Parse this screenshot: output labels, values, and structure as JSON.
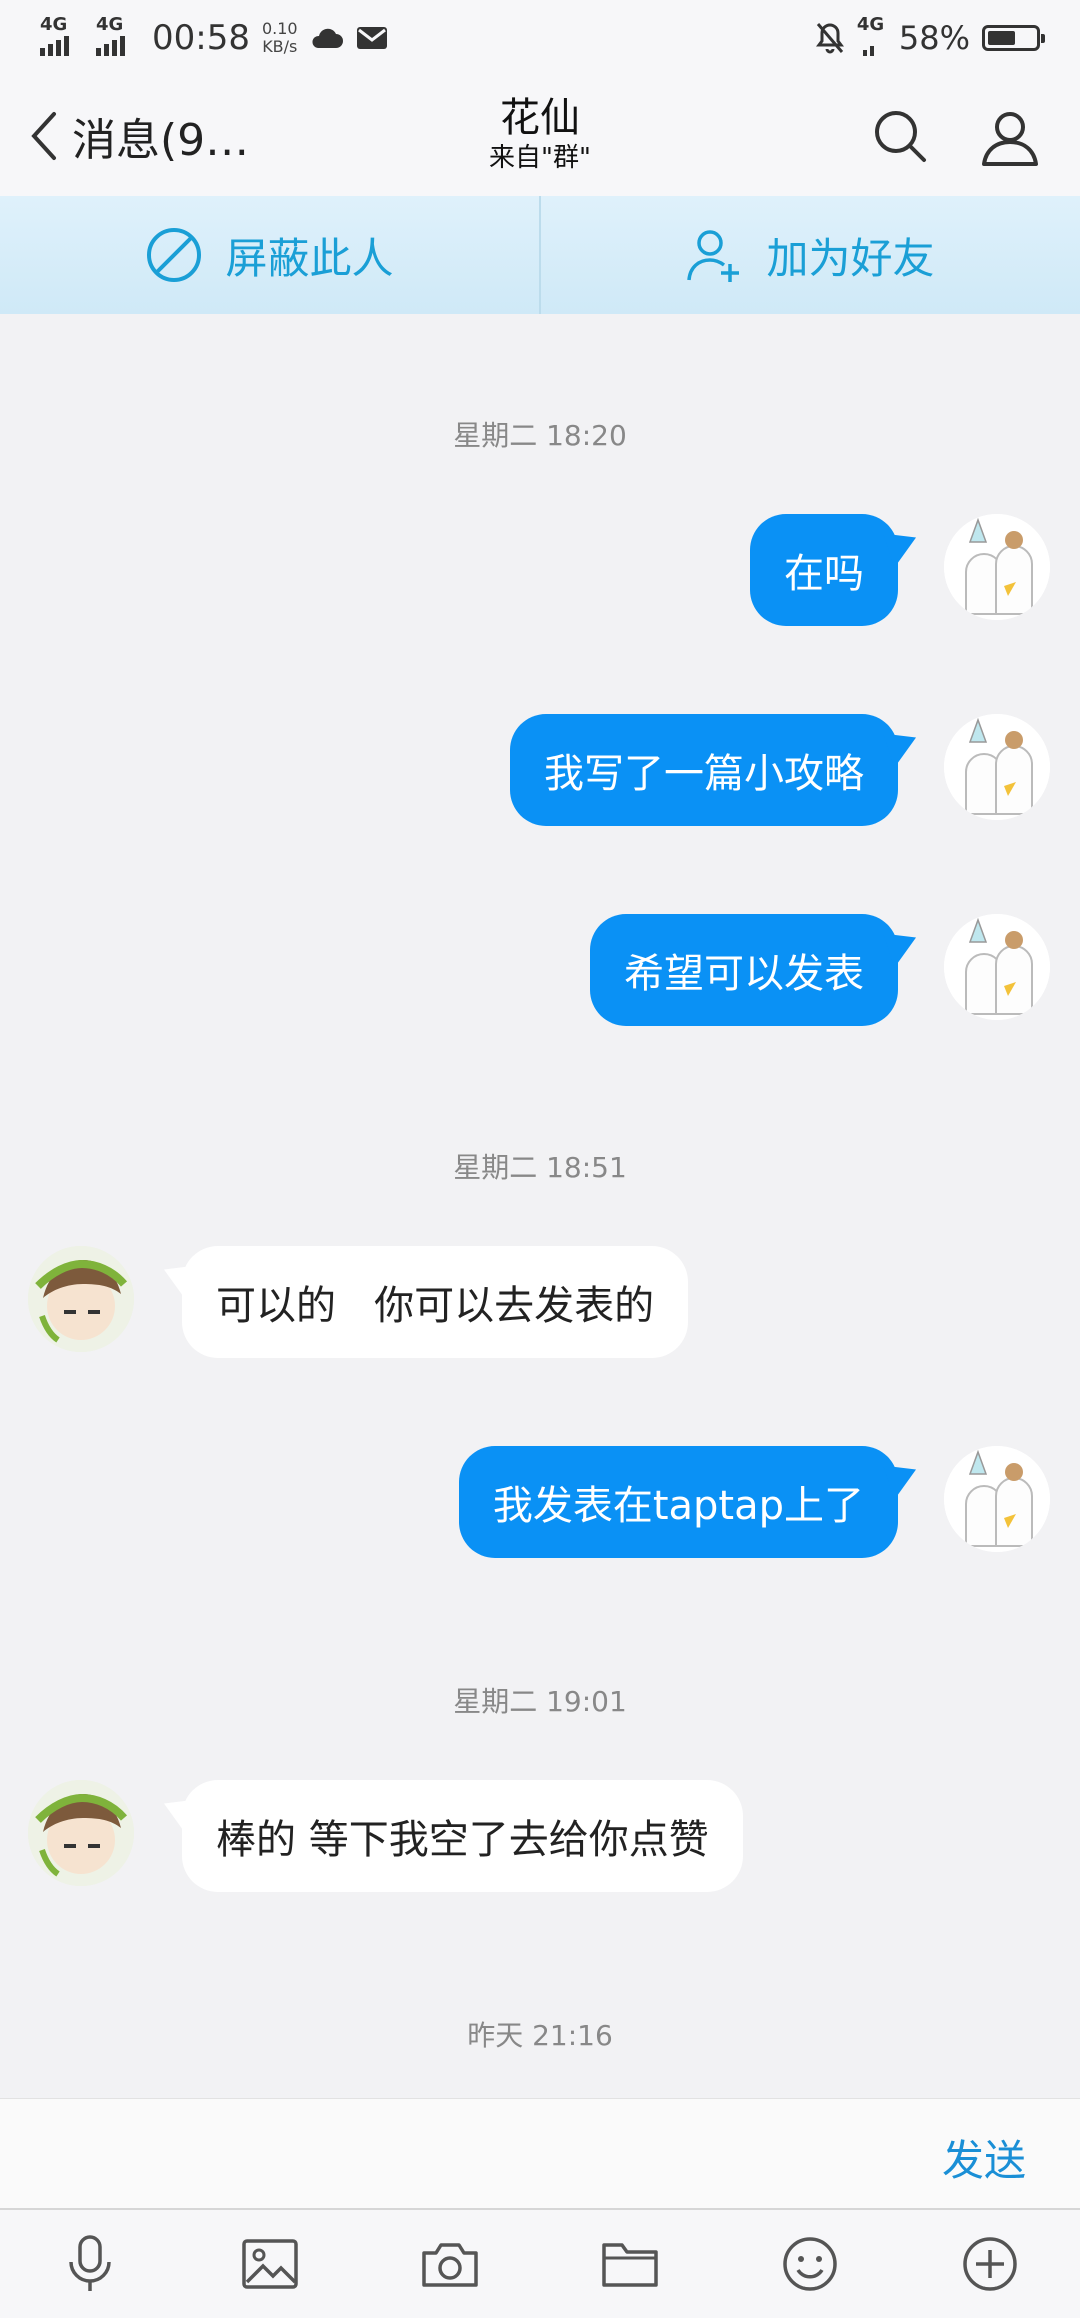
{
  "status_bar": {
    "network1": "4G",
    "network2": "4G",
    "time": "00:58",
    "speed_value": "0.10",
    "speed_unit": "KB/s",
    "network3": "4G",
    "battery_percent": "58%",
    "battery_level": 0.58
  },
  "header": {
    "back_label": "消息(9…",
    "contact_name": "花仙",
    "contact_source": "来自\"群\""
  },
  "actions": {
    "block_label": "屏蔽此人",
    "add_friend_label": "加为好友"
  },
  "chat": {
    "timestamps": [
      "星期二 18:20",
      "星期二 18:51",
      "星期二 19:01",
      "昨天 21:16"
    ],
    "messages": [
      {
        "side": "out",
        "text": "在吗"
      },
      {
        "side": "out",
        "text": "我写了一篇小攻略"
      },
      {
        "side": "out",
        "text": "希望可以发表"
      },
      {
        "side": "in",
        "text": "可以的   你可以去发表的"
      },
      {
        "side": "out",
        "text": "我发表在taptap上了"
      },
      {
        "side": "in",
        "text": "棒的 等下我空了去给你点赞"
      }
    ]
  },
  "input": {
    "placeholder": "",
    "send_label": "发送"
  },
  "colors": {
    "outgoing_bubble": "#0a91f5",
    "incoming_bubble": "#ffffff",
    "accent": "#1a9fd6"
  },
  "toolbar": {
    "icons": [
      "microphone-icon",
      "image-icon",
      "camera-icon",
      "folder-icon",
      "emoji-icon",
      "plus-icon"
    ]
  }
}
